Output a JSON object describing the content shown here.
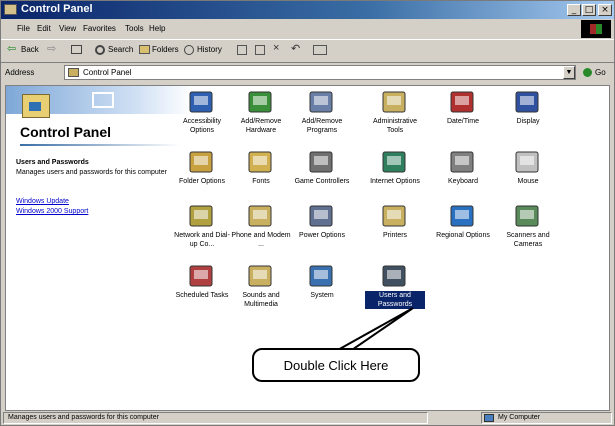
{
  "window": {
    "title": "Control Panel"
  },
  "title_buttons": {
    "minimize": "_",
    "maximize": "□",
    "close": "×"
  },
  "menu": [
    "File",
    "Edit",
    "View",
    "Favorites",
    "Tools",
    "Help"
  ],
  "toolbar": {
    "back": "Back",
    "search": "Search",
    "folders": "Folders",
    "history": "History"
  },
  "address": {
    "label": "Address",
    "value": "Control Panel",
    "go": "Go"
  },
  "left_pane": {
    "title": "Control Panel",
    "info_title": "Users and Passwords",
    "info_description": "Manages users and passwords for this computer",
    "links": [
      "Windows Update",
      "Windows 2000 Support"
    ]
  },
  "icons": [
    {
      "name": "accessibility",
      "label": "Accessibility Options",
      "icon": "accessibility-icon",
      "color": "#2e5fb0"
    },
    {
      "name": "add-hardware",
      "label": "Add/Remove Hardware",
      "icon": "hardware-icon",
      "color": "#3a8f3a"
    },
    {
      "name": "add-remove-programs",
      "label": "Add/Remove Programs",
      "icon": "programs-icon",
      "color": "#6a7fa8"
    },
    {
      "name": "admin-tools",
      "label": "Administrative Tools",
      "icon": "admin-tools-icon",
      "color": "#c8b060"
    },
    {
      "name": "date-time",
      "label": "Date/Time",
      "icon": "clock-icon",
      "color": "#b03030"
    },
    {
      "name": "display",
      "label": "Display",
      "icon": "display-icon",
      "color": "#3050a0"
    },
    {
      "name": "folder-options",
      "label": "Folder Options",
      "icon": "folder-options-icon",
      "color": "#c8a040"
    },
    {
      "name": "fonts",
      "label": "Fonts",
      "icon": "fonts-icon",
      "color": "#d0b050"
    },
    {
      "name": "game-controllers",
      "label": "Game Controllers",
      "icon": "joystick-icon",
      "color": "#707070"
    },
    {
      "name": "internet-options",
      "label": "Internet Options",
      "icon": "internet-icon",
      "color": "#2f7f5f"
    },
    {
      "name": "keyboard",
      "label": "Keyboard",
      "icon": "keyboard-icon",
      "color": "#808080"
    },
    {
      "name": "mouse",
      "label": "Mouse",
      "icon": "mouse-icon",
      "color": "#c0c0c0"
    },
    {
      "name": "network-dialup",
      "label": "Network and Dial-up Co...",
      "icon": "network-icon",
      "color": "#b0a040"
    },
    {
      "name": "phone-modem",
      "label": "Phone and Modem ...",
      "icon": "phone-icon",
      "color": "#c8b060"
    },
    {
      "name": "power-options",
      "label": "Power Options",
      "icon": "power-icon",
      "color": "#607090"
    },
    {
      "name": "printers",
      "label": "Printers",
      "icon": "printer-icon",
      "color": "#c8b060"
    },
    {
      "name": "regional-options",
      "label": "Regional Options",
      "icon": "globe-icon",
      "color": "#2a70c0"
    },
    {
      "name": "scanners-cameras",
      "label": "Scanners and Cameras",
      "icon": "scanner-icon",
      "color": "#5a8a5a"
    },
    {
      "name": "scheduled-tasks",
      "label": "Scheduled Tasks",
      "icon": "scheduled-tasks-icon",
      "color": "#b04040"
    },
    {
      "name": "sounds-multimedia",
      "label": "Sounds and Multimedia",
      "icon": "speaker-icon",
      "color": "#c8b060"
    },
    {
      "name": "system",
      "label": "System",
      "icon": "computer-icon",
      "color": "#3a70b0"
    },
    {
      "name": "users-passwords",
      "label": "Users and Passwords",
      "icon": "users-icon",
      "color": "#405060",
      "selected": true
    }
  ],
  "callout": {
    "text": "Double Click Here"
  },
  "status": {
    "text": "Manages users and passwords for this computer",
    "zone": "My Computer"
  }
}
